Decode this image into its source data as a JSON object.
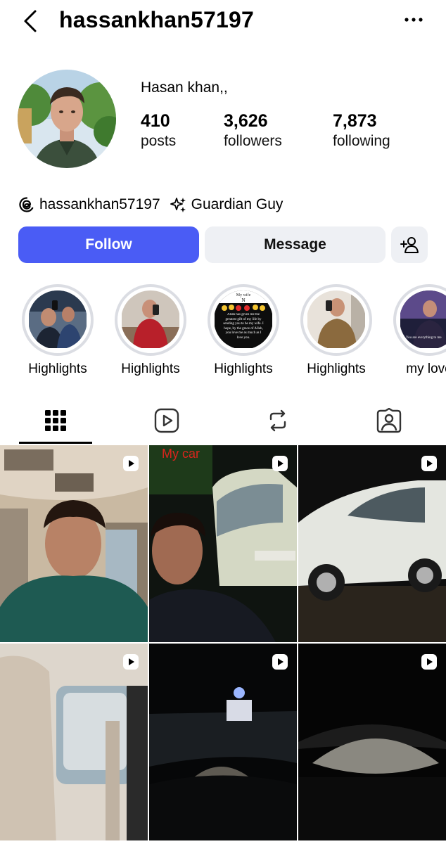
{
  "header": {
    "username": "hassankhan57197"
  },
  "profile": {
    "full_name": "Hasan khan,,",
    "stats": [
      {
        "value": "410",
        "label": "posts"
      },
      {
        "value": "3,626",
        "label": "followers"
      },
      {
        "value": "7,873",
        "label": "following"
      }
    ],
    "threads_handle": "hassankhan57197",
    "badge": "Guardian Guy"
  },
  "actions": {
    "follow": "Follow",
    "message": "Message"
  },
  "highlights": [
    {
      "label": "Highlights"
    },
    {
      "label": "Highlights"
    },
    {
      "label": "Highlights",
      "overlay_top": "My wife",
      "overlay_letter": "N",
      "overlay_text": "Allah has given me the greatest gift of my life by sending you to be my wife. I hope, by the grace of Allah, you love me as much as I love you."
    },
    {
      "label": "Highlights"
    },
    {
      "label": "my love",
      "overlay_text": "You are everything to me"
    }
  ],
  "tabs": [
    "posts-grid-icon",
    "reels-icon",
    "reposts-icon",
    "tagged-icon"
  ],
  "grid": {
    "items": [
      {
        "type": "reel"
      },
      {
        "type": "reel",
        "caption": "My car"
      },
      {
        "type": "reel"
      },
      {
        "type": "reel"
      },
      {
        "type": "reel"
      },
      {
        "type": "reel"
      }
    ]
  },
  "colors": {
    "accent": "#4a5cf5",
    "secondary_button": "#eef0f4",
    "ring": "#dbdde3"
  }
}
